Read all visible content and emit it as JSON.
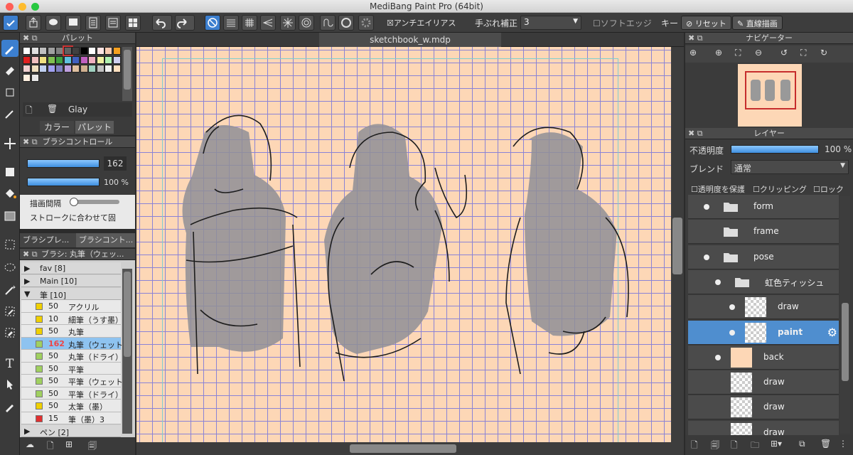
{
  "window": {
    "title": "MediBang Paint Pro (64bit)"
  },
  "toolbar": {
    "antialias": "アンチエイリアス",
    "stabilizer_label": "手ぶれ補正",
    "stabilizer_value": "3",
    "soft_edge": "ソフトエッジ",
    "key_label": "キー",
    "reset": "リセット",
    "straight_line": "直線描画"
  },
  "canvas": {
    "tab": "sketchbook_w.mdp"
  },
  "palette": {
    "title": "パレット",
    "color_name": "Glay",
    "tab_color": "カラー",
    "tab_palette": "パレット",
    "colors": [
      "#ffffff",
      "#e0e0e0",
      "#c0c0c0",
      "#a0a0a0",
      "#808080",
      "#606060",
      "#404040",
      "#000000",
      "#ffffff",
      "#ffe4e4",
      "#f7c9b0",
      "#f5a020",
      "#e02020",
      "#f0c0c0",
      "#f0e080",
      "#80c050",
      "#40a040",
      "#60c0e0",
      "#4060c0",
      "#c060c0",
      "#f0b0c0",
      "#f0f0a0",
      "#b0f0b0",
      "#d0d0f0",
      "#f0d0d0",
      "#f0e0c0",
      "#c0d0f0",
      "#a0a0f0",
      "#8080c0",
      "#c0a0e0",
      "#e0c0a0",
      "#d0b090",
      "#a0d0c0",
      "#c0c0c0",
      "#f0f0f0",
      "#ffe0c0",
      "#fff0e0",
      "#e8e8e8"
    ]
  },
  "brush_control": {
    "title": "ブラシコントロール",
    "size": "162",
    "opacity": "100 %",
    "interval_label": "描画間隔",
    "stroke_fit": "ストロークに合わせて固"
  },
  "brush_tabs": {
    "tab1": "ブラシプレ...",
    "tab2": "ブラシコント..."
  },
  "brush_list": {
    "title": "ブラシ: 丸筆（ウェッ...",
    "groups": [
      "fav [8]",
      "Main [10]",
      "筆 [10]",
      "ペン [2]"
    ],
    "items": [
      {
        "size": "50",
        "name": "アクリル",
        "color": "#f0d000"
      },
      {
        "size": "10",
        "name": "細筆（うす墨）",
        "color": "#f0d000"
      },
      {
        "size": "50",
        "name": "丸筆",
        "color": "#f0d000"
      },
      {
        "size": "162",
        "name": "丸筆（ウェット）",
        "color": "#a0d060"
      },
      {
        "size": "50",
        "name": "丸筆（ドライ）",
        "color": "#a0d060"
      },
      {
        "size": "50",
        "name": "平筆",
        "color": "#a0d060"
      },
      {
        "size": "50",
        "name": "平筆（ウェット）",
        "color": "#a0d060"
      },
      {
        "size": "50",
        "name": "平筆（ドライ）",
        "color": "#a0d060"
      },
      {
        "size": "50",
        "name": "太筆（墨）",
        "color": "#f0d000"
      },
      {
        "size": "15",
        "name": "筆（墨）3",
        "color": "#e03030"
      }
    ]
  },
  "navigator": {
    "title": "ナビゲーター"
  },
  "layers": {
    "title": "レイヤー",
    "opacity_label": "不透明度",
    "opacity_value": "100 %",
    "blend_label": "ブレンド",
    "blend_value": "通常",
    "protect_alpha": "透明度を保護",
    "clipping": "クリッピング",
    "lock": "ロック",
    "rows": [
      {
        "name": "form",
        "kind": "folder",
        "eye": true
      },
      {
        "name": "frame",
        "kind": "folder",
        "eye": false
      },
      {
        "name": "pose",
        "kind": "folder",
        "eye": true
      },
      {
        "name": "虹色ティッシュ",
        "kind": "folder",
        "eye": true
      },
      {
        "name": "draw",
        "kind": "layer",
        "eye": true
      },
      {
        "name": "paint",
        "kind": "layer",
        "eye": true
      },
      {
        "name": "back",
        "kind": "layer",
        "eye": true
      },
      {
        "name": "draw",
        "kind": "layer",
        "eye": false
      },
      {
        "name": "draw",
        "kind": "layer",
        "eye": false
      },
      {
        "name": "draw",
        "kind": "layer",
        "eye": false
      }
    ]
  }
}
